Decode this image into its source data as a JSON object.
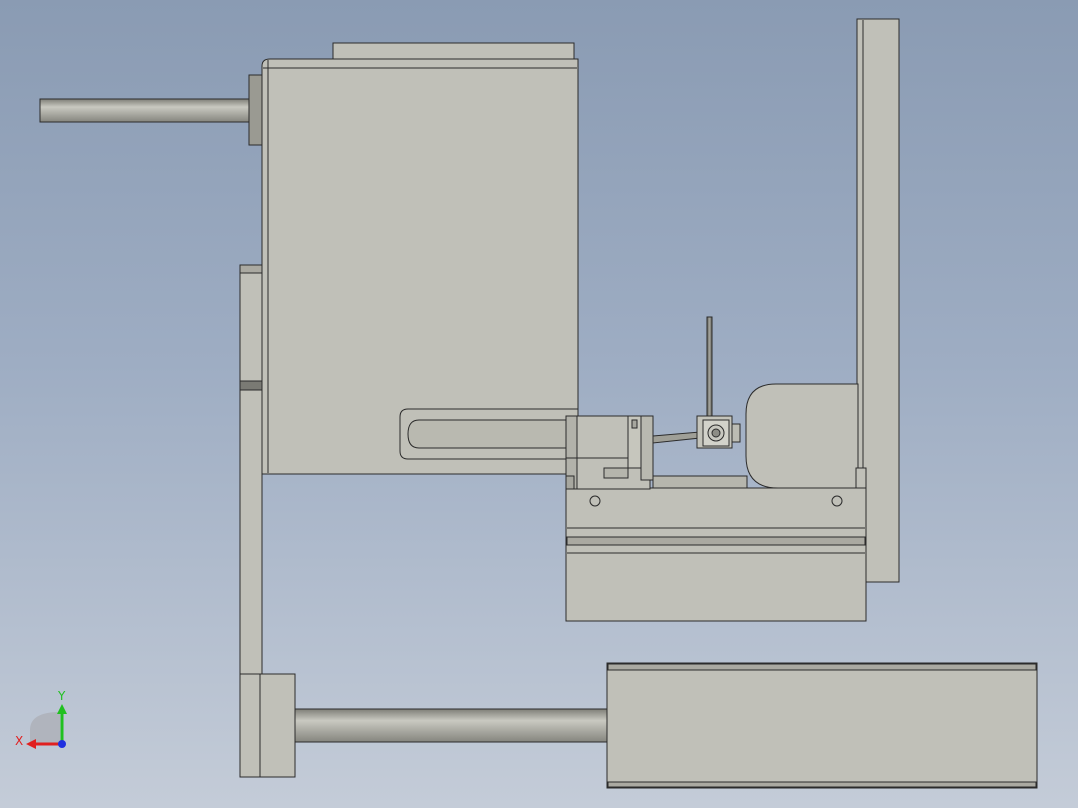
{
  "view": {
    "colors": {
      "background_top": "#8a9bb3",
      "background_bottom": "#c4ccd8",
      "part_fill": "#c0c0b8",
      "part_shade": "#b4b4ab",
      "outline": "#2b2b2b",
      "shaft": "#9c9c94"
    }
  },
  "triad": {
    "x_label": "X",
    "y_label": "Y",
    "x_color": "#e02020",
    "y_color": "#20c020",
    "z_color": "#2030e0"
  }
}
